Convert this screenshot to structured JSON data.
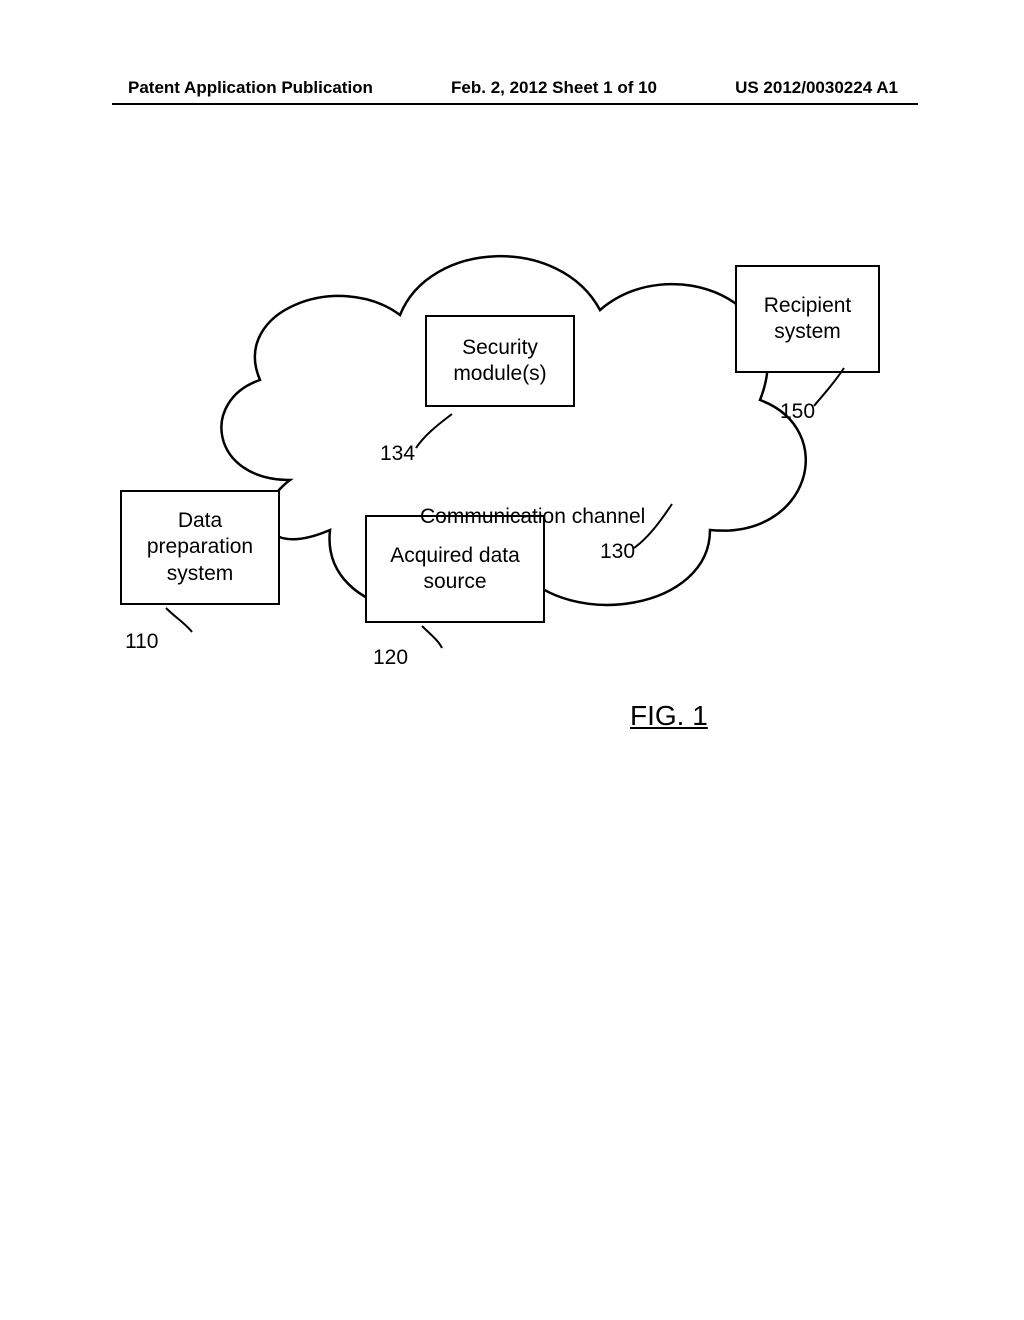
{
  "header": {
    "left": "Patent Application Publication",
    "center": "Feb. 2, 2012  Sheet 1 of 10",
    "right": "US 2012/0030224 A1"
  },
  "boxes": {
    "data_preparation_system": "Data\npreparation\nsystem",
    "acquired_data_source": "Acquired data\nsource",
    "security_modules": "Security\nmodule(s)",
    "recipient_system": "Recipient\nsystem"
  },
  "leads": {
    "n110": "110",
    "n120": "120",
    "n130": "130",
    "n134": "134",
    "n150": "150"
  },
  "cloud_label": "Communication channel",
  "figure_label": "FIG. 1"
}
